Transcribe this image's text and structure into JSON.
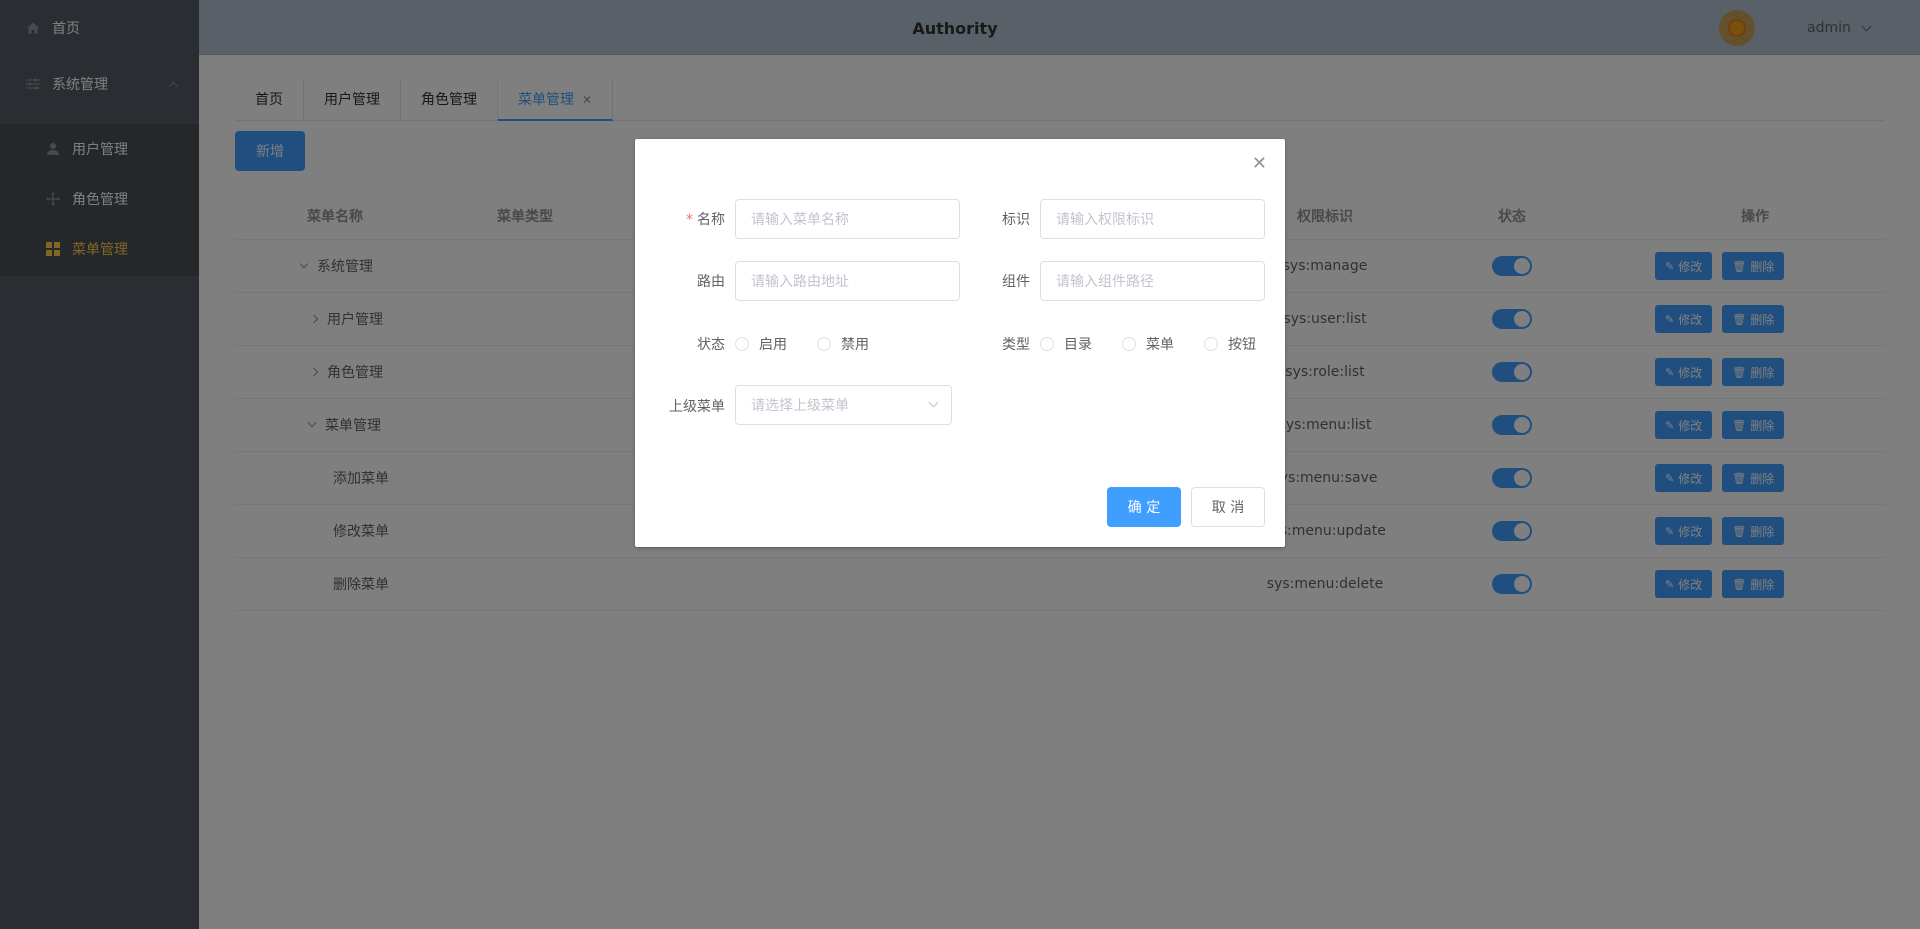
{
  "sidebar": {
    "home": "首页",
    "system": "系统管理",
    "items": [
      {
        "label": "用户管理"
      },
      {
        "label": "角色管理"
      },
      {
        "label": "菜单管理"
      }
    ]
  },
  "header": {
    "title": "Authority",
    "user": "admin"
  },
  "tabs": [
    "首页",
    "用户管理",
    "角色管理",
    "菜单管理"
  ],
  "toolbar": {
    "add_label": "新增"
  },
  "table": {
    "headers": {
      "name": "菜单名称",
      "type": "菜单类型",
      "perm": "权限标识",
      "status": "状态",
      "ops": "操作"
    },
    "rows": [
      {
        "name": "系统管理",
        "perm": "sys:manage"
      },
      {
        "name": "用户管理",
        "perm": "sys:user:list"
      },
      {
        "name": "角色管理",
        "perm": "sys:role:list"
      },
      {
        "name": "菜单管理",
        "perm": "sys:menu:list"
      },
      {
        "name": "添加菜单",
        "perm": "sys:menu:save"
      },
      {
        "name": "修改菜单",
        "perm": "sys:menu:update"
      },
      {
        "name": "删除菜单",
        "perm": "sys:menu:delete"
      }
    ],
    "edit_label": "修改",
    "delete_label": "删除"
  },
  "dialog": {
    "name_label": "名称",
    "name_placeholder": "请输入菜单名称",
    "perm_label": "标识",
    "perm_placeholder": "请输入权限标识",
    "route_label": "路由",
    "route_placeholder": "请输入路由地址",
    "component_label": "组件",
    "component_placeholder": "请输入组件路径",
    "status_label": "状态",
    "status_options": [
      "启用",
      "禁用"
    ],
    "type_label": "类型",
    "type_options": [
      "目录",
      "菜单",
      "按钮"
    ],
    "parent_label": "上级菜单",
    "parent_placeholder": "请选择上级菜单",
    "ok_label": "确 定",
    "cancel_label": "取 消"
  }
}
